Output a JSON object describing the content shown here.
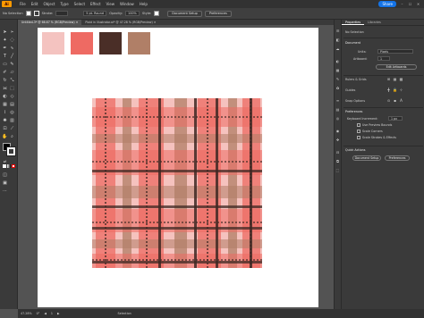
{
  "app": {
    "logo": "Ai"
  },
  "menu": [
    "File",
    "Edit",
    "Object",
    "Type",
    "Select",
    "Effect",
    "View",
    "Window",
    "Help"
  ],
  "topright": {
    "share": "Share"
  },
  "control": {
    "selection": "No Selection",
    "stroke_label": "Stroke:",
    "brush": "5 pt. Round",
    "opacity_label": "Opacity:",
    "opacity": "100%",
    "style_label": "Style:",
    "doc_setup": "Document Setup",
    "preferences": "Preferences"
  },
  "tabs": [
    {
      "label": "Untitled-3* @ 66.67 % (RGB/Preview)"
    },
    {
      "label": "Plaid in Illustrator.ai* @ 47.28 % (RGB/Preview)"
    }
  ],
  "swatches": [
    "#f4c3c0",
    "#ee6a63",
    "#4a2e27",
    "#b07f67"
  ],
  "plaid_colors": {
    "base": "#f5c2be",
    "coral": "#ec6b63",
    "brown": "#b07e66",
    "dark": "#3e2823"
  },
  "props": {
    "tab_properties": "Properties",
    "tab_libraries": "Libraries",
    "no_selection": "No Selection",
    "document": "Document",
    "units_label": "Units:",
    "units": "Pixels",
    "artboard_label": "Artboard:",
    "artboard": "1",
    "edit_artboards": "Edit Artboards",
    "rulers_grids": "Rulers & Grids",
    "guides": "Guides",
    "snap_options": "Snap Options",
    "preferences": "Preferences",
    "keyboard_increment": "Keyboard Increment:",
    "increment_value": "1 px",
    "use_preview_bounds": "Use Preview Bounds",
    "scale_corners": "Scale Corners",
    "scale_strokes": "Scale Strokes & Effects",
    "quick_actions": "Quick Actions",
    "doc_setup": "Document Setup",
    "preferences_btn": "Preferences"
  },
  "status": {
    "zoom": "47.28%",
    "rotation": "0°",
    "artboard": "1",
    "mode": "Selection"
  }
}
